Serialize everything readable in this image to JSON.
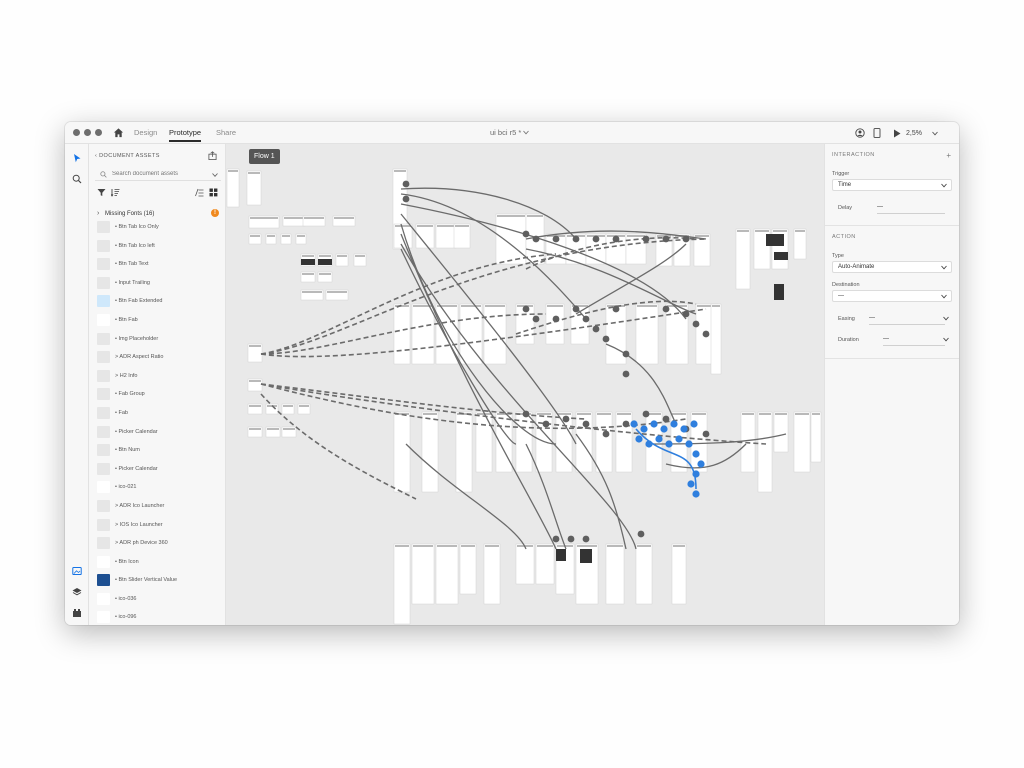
{
  "titlebar": {
    "tabs": [
      {
        "label": "Design",
        "active": false
      },
      {
        "label": "Prototype",
        "active": true
      },
      {
        "label": "Share",
        "active": false
      }
    ],
    "doc_title": "ui bci r5 *",
    "zoom": "2,5%"
  },
  "assets": {
    "header": "DOCUMENT ASSETS",
    "search_placeholder": "Search document assets",
    "missing_fonts": "Missing Fonts (16)",
    "warn_glyph": "!",
    "items": [
      "• Btn Tab Ico Only",
      "• Btn Tab Ico left",
      "• Btn Tab Text",
      "• Input Trailing",
      "• Btn Fab Extended",
      "• Btn Fab",
      "• Img Placeholder",
      "> ADR Aspect Ratio",
      "> H2 Info",
      "• Fab Group",
      "• Fab",
      "• Picker Calendar",
      "• Btn Num",
      "• Picker Calendar",
      "• ico-021",
      "> ADR Ico Launcher",
      "> IOS Ico Launcher",
      "> ADR ph Device 360",
      "• Btn Icon",
      "• Btn Slider Vertical Value",
      "• ico-036",
      "• ico-096"
    ]
  },
  "canvas": {
    "flow_label": "Flow 1"
  },
  "props": {
    "interaction_title": "INTERACTION",
    "plus": "+",
    "trigger_label": "Trigger",
    "trigger_value": "Time",
    "delay_label": "Delay",
    "delay_value": "—",
    "action_title": "ACTION",
    "type_label": "Type",
    "type_value": "Auto-Animate",
    "destination_label": "Destination",
    "destination_value": "—",
    "easing_label": "Easing",
    "easing_value": "—",
    "duration_label": "Duration",
    "duration_value": "—"
  }
}
